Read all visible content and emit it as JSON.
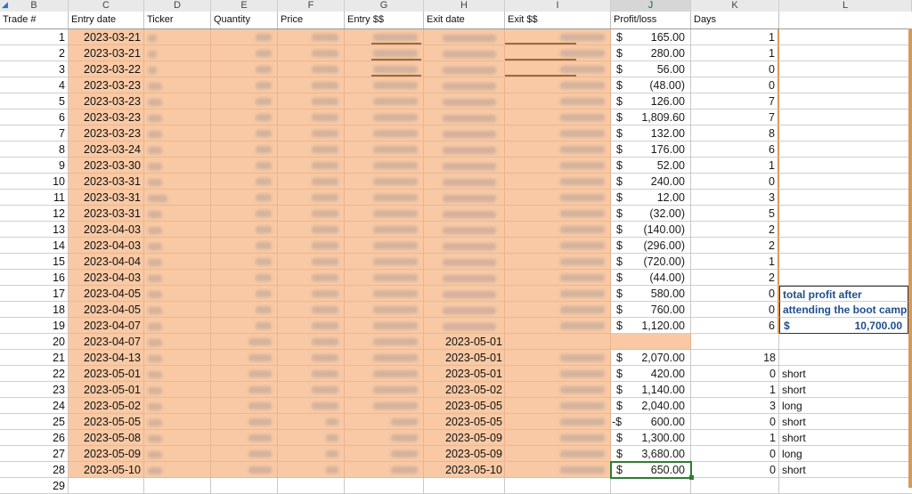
{
  "column_letters": [
    "B",
    "C",
    "D",
    "E",
    "F",
    "G",
    "H",
    "I",
    "J",
    "K",
    "L"
  ],
  "headers": {
    "trade": "Trade #",
    "entry_date": "Entry date",
    "ticker": "Ticker",
    "quantity": "Quantity",
    "price": "Price",
    "entry_value": "Entry $$",
    "exit_date": "Exit date",
    "exit_value": "Exit $$",
    "profit_loss": "Profit/loss",
    "days": "Days"
  },
  "currency_symbol": "$",
  "rows": [
    {
      "n": "1",
      "entry": "2023-03-21",
      "exit": "",
      "pl": "165.00",
      "neg": false,
      "days": "1",
      "side": ""
    },
    {
      "n": "2",
      "entry": "2023-03-21",
      "exit": "",
      "pl": "280.00",
      "neg": false,
      "days": "1",
      "side": ""
    },
    {
      "n": "3",
      "entry": "2023-03-22",
      "exit": "",
      "pl": "56.00",
      "neg": false,
      "days": "0",
      "side": ""
    },
    {
      "n": "4",
      "entry": "2023-03-23",
      "exit": "",
      "pl": "(48.00)",
      "neg": false,
      "days": "0",
      "side": ""
    },
    {
      "n": "5",
      "entry": "2023-03-23",
      "exit": "",
      "pl": "126.00",
      "neg": false,
      "days": "7",
      "side": ""
    },
    {
      "n": "6",
      "entry": "2023-03-23",
      "exit": "",
      "pl": "1,809.60",
      "neg": false,
      "days": "7",
      "side": ""
    },
    {
      "n": "7",
      "entry": "2023-03-23",
      "exit": "",
      "pl": "132.00",
      "neg": false,
      "days": "8",
      "side": ""
    },
    {
      "n": "8",
      "entry": "2023-03-24",
      "exit": "",
      "pl": "176.00",
      "neg": false,
      "days": "6",
      "side": ""
    },
    {
      "n": "9",
      "entry": "2023-03-30",
      "exit": "",
      "pl": "52.00",
      "neg": false,
      "days": "1",
      "side": ""
    },
    {
      "n": "10",
      "entry": "2023-03-31",
      "exit": "",
      "pl": "240.00",
      "neg": false,
      "days": "0",
      "side": ""
    },
    {
      "n": "11",
      "entry": "2023-03-31",
      "exit": "",
      "pl": "12.00",
      "neg": false,
      "days": "3",
      "side": ""
    },
    {
      "n": "12",
      "entry": "2023-03-31",
      "exit": "",
      "pl": "(32.00)",
      "neg": false,
      "days": "5",
      "side": ""
    },
    {
      "n": "13",
      "entry": "2023-04-03",
      "exit": "",
      "pl": "(140.00)",
      "neg": false,
      "days": "2",
      "side": ""
    },
    {
      "n": "14",
      "entry": "2023-04-03",
      "exit": "",
      "pl": "(296.00)",
      "neg": false,
      "days": "2",
      "side": ""
    },
    {
      "n": "15",
      "entry": "2023-04-04",
      "exit": "",
      "pl": "(720.00)",
      "neg": false,
      "days": "1",
      "side": ""
    },
    {
      "n": "16",
      "entry": "2023-04-03",
      "exit": "",
      "pl": "(44.00)",
      "neg": false,
      "days": "2",
      "side": ""
    },
    {
      "n": "17",
      "entry": "2023-04-05",
      "exit": "",
      "pl": "580.00",
      "neg": false,
      "days": "0",
      "side": ""
    },
    {
      "n": "18",
      "entry": "2023-04-05",
      "exit": "",
      "pl": "760.00",
      "neg": false,
      "days": "0",
      "side": ""
    },
    {
      "n": "19",
      "entry": "2023-04-07",
      "exit": "",
      "pl": "1,120.00",
      "neg": false,
      "days": "6",
      "side": ""
    },
    {
      "n": "20",
      "entry": "2023-04-07",
      "exit": "2023-05-01",
      "pl": "",
      "neg": false,
      "days": "",
      "side": ""
    },
    {
      "n": "21",
      "entry": "2023-04-13",
      "exit": "2023-05-01",
      "pl": "2,070.00",
      "neg": false,
      "days": "18",
      "side": ""
    },
    {
      "n": "22",
      "entry": "2023-05-01",
      "exit": "2023-05-01",
      "pl": "420.00",
      "neg": false,
      "days": "0",
      "side": "short"
    },
    {
      "n": "23",
      "entry": "2023-05-01",
      "exit": "2023-05-02",
      "pl": "1,140.00",
      "neg": false,
      "days": "1",
      "side": "short"
    },
    {
      "n": "24",
      "entry": "2023-05-02",
      "exit": "2023-05-05",
      "pl": "2,040.00",
      "neg": false,
      "days": "3",
      "side": "long"
    },
    {
      "n": "25",
      "entry": "2023-05-05",
      "exit": "2023-05-05",
      "pl": "600.00",
      "neg": true,
      "days": "0",
      "side": "short"
    },
    {
      "n": "26",
      "entry": "2023-05-08",
      "exit": "2023-05-09",
      "pl": "1,300.00",
      "neg": false,
      "days": "1",
      "side": "short"
    },
    {
      "n": "27",
      "entry": "2023-05-09",
      "exit": "2023-05-09",
      "pl": "3,680.00",
      "neg": false,
      "days": "0",
      "side": "long"
    },
    {
      "n": "28",
      "entry": "2023-05-10",
      "exit": "2023-05-10",
      "pl": "650.00",
      "neg": false,
      "days": "0",
      "side": "short"
    },
    {
      "n": "29",
      "entry": "",
      "exit": "",
      "pl": "",
      "neg": false,
      "days": "",
      "side": ""
    }
  ],
  "summary": {
    "label_line1": "total profit after",
    "label_line2": "attending the boot camp",
    "total": "10,700.00"
  },
  "colors": {
    "highlight": "#f8c9a4",
    "note_text": "#1f4f8a",
    "selection": "#2e7d32"
  }
}
